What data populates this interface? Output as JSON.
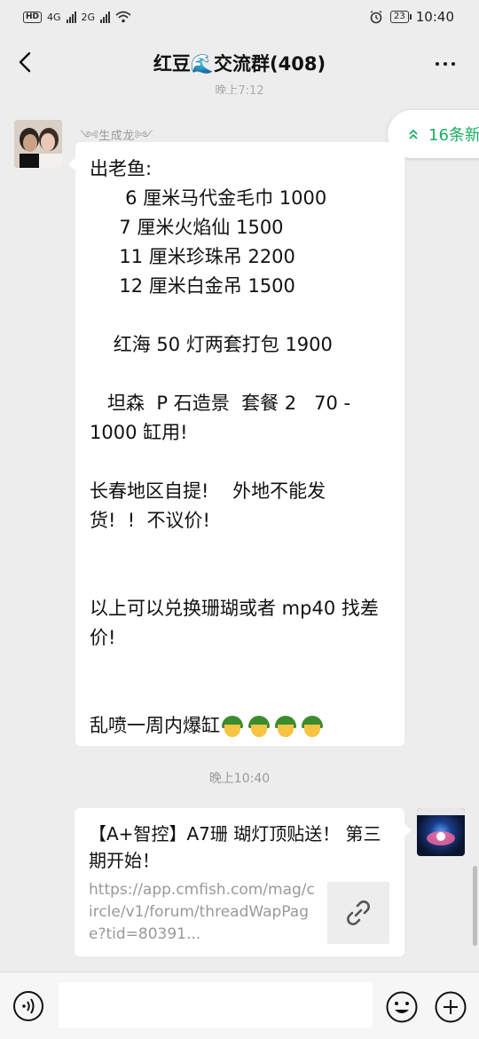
{
  "status_bar": {
    "hd": "HD",
    "net1": "4G",
    "net2": "2G",
    "battery": "23",
    "time": "10:40"
  },
  "header": {
    "title": "红豆🌊交流群(408)"
  },
  "chat": {
    "partial_time": "晚上7:12",
    "sender_name": "༺生成龙༻",
    "new_messages": "16条新",
    "message_text": "出老鱼:\n      6 厘米马代金毛巾 1000\n     7 厘米火焰仙 1500\n     11 厘米珍珠吊 2200\n     12 厘米白金吊 1500\n\n    红海 50 灯两套打包 1900\n\n   坦森  P 石造景  套餐 2   70 -\n1000 缸用!\n\n长春地区自提!    外地不能发\n货!  !  不议价!\n\n\n以上可以兑换珊瑚或者 mp40 找差\n价!\n\n\n乱喷一周内爆缸",
    "time_mid": "晚上10:40",
    "card": {
      "title": "【A+智控】A7珊 瑚灯顶贴送！ 第三期开始！",
      "desc": "https://app.cmfish.com/mag/circle/v1/forum/threadWapPage?tid=80391..."
    }
  },
  "icons": {
    "back": "chevron-left-icon",
    "more": "more-dots-icon",
    "new_messages": "double-chevron-up-icon",
    "link": "link-icon",
    "voice": "voice-icon",
    "emoji": "emoji-icon",
    "plus": "plus-icon"
  },
  "colors": {
    "background": "#ededed",
    "accent_green": "#1aad62",
    "bubble": "#ffffff"
  }
}
